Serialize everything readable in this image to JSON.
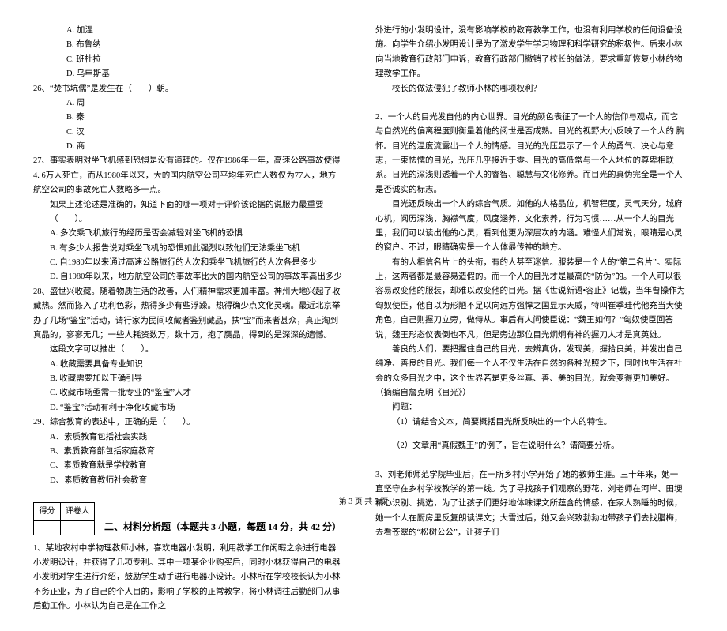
{
  "left": {
    "opts25": [
      "A. 加涅",
      "B. 布鲁纳",
      "C. 班杜拉",
      "D. 乌申斯基"
    ],
    "q26": "26、“焚书坑儒”是发生在（　　）朝。",
    "opts26": [
      "A. 周",
      "B. 秦",
      "C. 汉",
      "D. 商"
    ],
    "q27": "27、事实表明对坐飞机感到恐惧是没有道理的。仅在1986年一年，高速公路事故使得4. 6万人死亡，而从1980年以来，大的国内航空公司平均年死亡人数仅为77人，地方航空公司的事故死亡人数略多一点。",
    "q27s": "如果上述论述是准确的，知道下面的哪一项对于评价该论据的说服力最重要（　　）。",
    "opts27": [
      "A. 多次乘飞机旅行的经历是否会减轻对坐飞机的恐惧",
      "B. 有多少人报告说对乘坐飞机的恐惧如此强烈以致他们无法乘坐飞机",
      "C. 自1980年以来通过高速公路旅行的人次和乘坐飞机旅行的人次各是多少",
      "D. 自1980年以来，地方航空公司的事故率比大的国内航空公司的事故率高出多少"
    ],
    "q28a": "28、盛世兴收藏。随着物质生活的改善，人们精神需求更加丰富。神州大地兴起了收藏热。然而搽入了功利色彩，热得多少有些浮躁。热得确少点文化灵魂。最近北京举办了几场“鉴宝”活动，请行家为民间收藏者鉴别藏品，扶“宝”而来者甚众，真正淘到真品的，寥寥无几；一些人耗资数万，数十万，抱了赝品，得到的是深深的遗憾。",
    "q28b": "这段文字可以推出（　　）。",
    "opts28": [
      "A. 收藏需要具备专业知识",
      "B. 收藏需要加以正确引导",
      "C. 收藏市场亟需一批专业的“鉴宝”人才",
      "D. “鉴宝”活动有利于净化收藏市场"
    ],
    "q29": "29、综合教育的表述中，正确的是（　　）。",
    "opts29": [
      "A、素质教育包括社会实践",
      "B、素质教育部包括家庭教育",
      "C、素质教育就是学校教育",
      "D、素质教育教师社会教育"
    ],
    "scorebox": {
      "c1": "得分",
      "c2": "评卷人"
    },
    "section2": "二、材料分析题（本题共 3 小题，每题 14 分，共 42 分）",
    "m1": "1、某地农村中学物理教师小林，喜欢电器小发明，利用教学工作闲暇之余进行电器小发明设计，并获得了几项专利。其中一项某企业购买后，同时小林获得自己的电器小发明对学生进行介绍，鼓励学生动手进行电器小设计。小林所在学校校长认为小林不务正业，为了自己的个人目的，影响了学校的正常教学，将小林调往后勤部门从事后勤工作。小林认为自己是在工作之"
  },
  "right": {
    "p1": "外进行的小发明设计，没有影响学校的教育教学工作，也没有利用学校的任何设备设施。向学生介绍小发明设计是为了激发学生学习物理和科学研究的积极性。后来小林向当地教育行政部门申诉，教育行政部门撤销了校长的做法，要求重新恢复小林的物理教学工作。",
    "p1q": "校长的做法侵犯了教师小林的哪项权利？",
    "m2a": "2、一个人的目光发自他的内心世界。目光的颜色表征了一个人的信仰与观点，而它与自然光的偏离程度则衡量着他的阅世是否成熟。目光的视野大小反映了一个人的\t胸怀。目光的温度流露出一个人的情感。目光的光压显示了一个人的勇气、决心与意志，一束怯懦的目光，光压几乎接近于零。目光的高低常与一个人地位的尊卑相联系。日光的深浅则透着一个人的睿智、聪慧与文化修养。而目光的真伪完全是一个人是否诚实的标志。",
    "m2b": "目光还反映出一个人的综合气质。如他的人格品位，机智程度，灵气天分，城府心机，阅历深浅，胸襟气度，风度涵养，文化素养，行为习惯……从一个人的目光里，我们可以读出他的心灵，看到他更为深层次的内涵。难怪人们常说，眼睛是心灵的窗户。不过，眼睛确实是一个人体最传神的地方。",
    "m2c": "有的人相信名片上的头衔，有的人甚至迷信。服装是一个人的“第二名片”。实际上，这两者都是最容易造假的。而一个人的目光才是最高的“防伪”的。一个人可以很容易改变他的服装，却难以改变他的目光。据《世说新语•容止》记载，当年曹操作为匈奴使臣，他自以为形陋不足以向远方强悍之国显示天威，特叫崔季珪代他充当大使角色，自己则握刀立旁，做侍从。事后有人问使臣说：“魏王如何？”匈奴使臣回答说，魏王形态仪表倒也不凡，但是旁边那位目光炯炯有神的握刀人才是真英雄。",
    "m2d": "善良的人们，要把握住自己的目光，去辨真伪，发现美，摒拾良美，并发出自己纯净、善良的目光。我们每一个人不仅生活在自然的各种光照之下，同时也生活在社会的众多目光之中，这个世界若是更多丝真、善、美的目光，就会变得更加美好。（摘编自詹克明《目光》）",
    "m2q": "问题：",
    "m2q1": "（1）请结合文本，简要概括目光所反映出的一个人的特性。",
    "m2q2": "（2）文章用“真假魏王”的例子，旨在说明什么？请简要分析。",
    "m3a": "3、刘老师师范学院毕业后，在一所乡村小学开始了她的教师生涯。三十年来，她一直坚守在乡村学校教学的第一线。为了寻找孩子们观察的野花，刘老师在河岸、田埂精心识别、挑选，为了让孩子们更好地体味课文所蕴含的情感，在家人熟睡的时候，她一个人在厨房里反复朗读课文；大雪过后，她又会兴致勃勃地带孩子们去找腊梅，去看苍翠的“松树公公”，让孩子们"
  },
  "footer": "第 3 页 共 5 页"
}
